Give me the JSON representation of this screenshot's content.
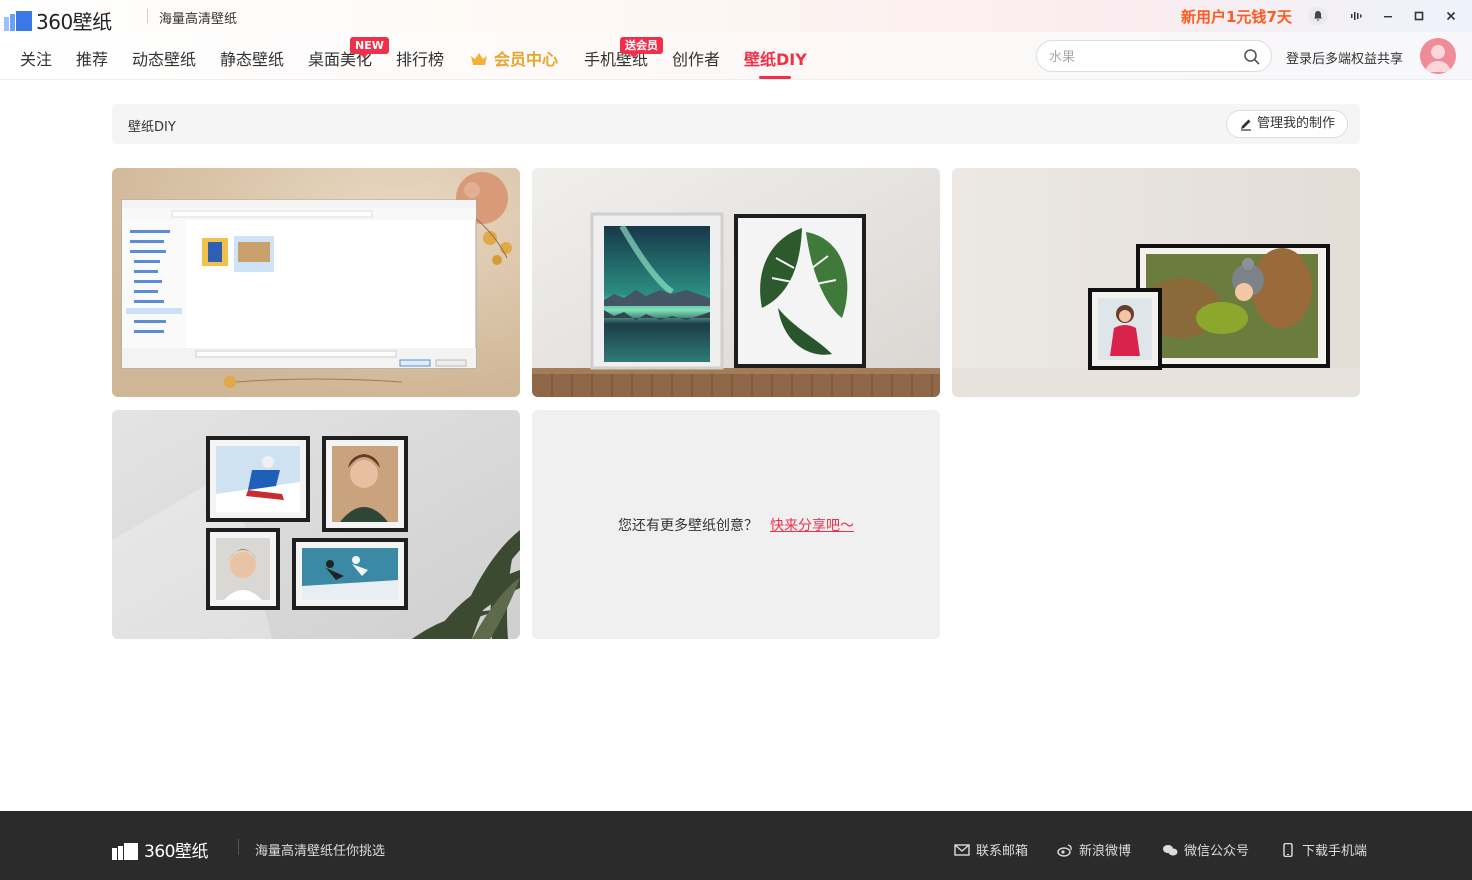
{
  "app": {
    "logo_text": "360壁纸",
    "slogan": "海量高清壁纸",
    "promo": "新用户1元钱7天"
  },
  "window_controls": {
    "bell": "bell-icon",
    "audio": "waveform-icon",
    "minimize": "minimize-icon",
    "maximize": "maximize-icon",
    "close": "close-icon"
  },
  "nav": {
    "items": [
      {
        "label": "关注"
      },
      {
        "label": "推荐"
      },
      {
        "label": "动态壁纸"
      },
      {
        "label": "静态壁纸"
      },
      {
        "label": "桌面美化",
        "badge": "NEW"
      },
      {
        "label": "排行榜"
      },
      {
        "label": "会员中心"
      },
      {
        "label": "手机壁纸",
        "badge": "送会员"
      },
      {
        "label": "创作者"
      },
      {
        "label": "壁纸DIY",
        "active": true
      }
    ],
    "search_placeholder": "水果",
    "login_text": "登录后多端权益共享"
  },
  "breadcrumb": {
    "title": "壁纸DIY",
    "manage_label": "管理我的制作"
  },
  "grid": {
    "cards": [
      {
        "scene": "desktop-file-dialog"
      },
      {
        "scene": "framed-aurora-and-monstera"
      },
      {
        "scene": "framed-child-portraits"
      },
      {
        "scene": "framed-photo-wall"
      },
      {
        "scene": "share-prompt"
      }
    ],
    "more_text": "您还有更多壁纸创意？",
    "more_link": "快来分享吧～"
  },
  "footer": {
    "logo_text": "360壁纸",
    "slogan": "海量高清壁纸任你挑选",
    "links": [
      "联系邮箱",
      "新浪微博",
      "微信公众号",
      "下载手机端"
    ]
  },
  "colors": {
    "accent": "#f0304a",
    "promo": "#ff5a1f",
    "vip": "#e7a52c",
    "footer_bg": "#2b2b2b"
  }
}
